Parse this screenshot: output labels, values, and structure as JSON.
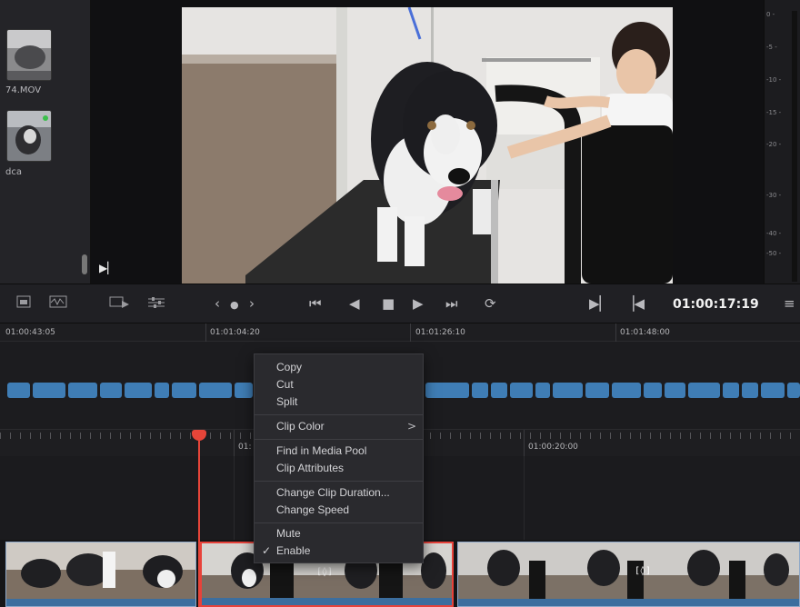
{
  "media_pool": {
    "items": [
      {
        "label": "74.MOV"
      },
      {
        "label": "dca"
      }
    ]
  },
  "audio_meter": {
    "labels": [
      "0 -",
      "-5 -",
      "-10 -",
      "-15 -",
      "-20 -",
      "-30 -",
      "-40 -",
      "-50 -"
    ]
  },
  "transport": {
    "timecode": "01:00:17:19",
    "buttons": [
      "media-pool-view",
      "audio-view",
      "clip-view",
      "inspector",
      "jog-prev",
      "jog-dot",
      "jog-next",
      "go-start",
      "prev-frame",
      "stop",
      "play",
      "go-end",
      "loop",
      "mark-in",
      "mark-out",
      "options"
    ]
  },
  "upper_ruler": {
    "labels": [
      "01:00:43:05",
      "01:01:04:20",
      "01:01:26:10",
      "01:01:48:00"
    ]
  },
  "lower_ruler": {
    "labels": [
      "01:",
      "01:00:20:00"
    ]
  },
  "context_menu": {
    "items": {
      "copy": "Copy",
      "cut": "Cut",
      "split": "Split",
      "clip_color": "Clip Color",
      "find_in_media_pool": "Find in Media Pool",
      "clip_attributes": "Clip Attributes",
      "change_clip_duration": "Change Clip Duration...",
      "change_speed": "Change Speed",
      "mute": "Mute",
      "enable": "Enable"
    },
    "enable_checked": true,
    "submenu_arrow": ">",
    "check_mark": "✓"
  },
  "timeline": {
    "fx_badge": "[◊]"
  },
  "colors": {
    "playhead": "#e64539",
    "clip_blue": "#3f7db5",
    "selected_clip_border": "#e8423a"
  }
}
